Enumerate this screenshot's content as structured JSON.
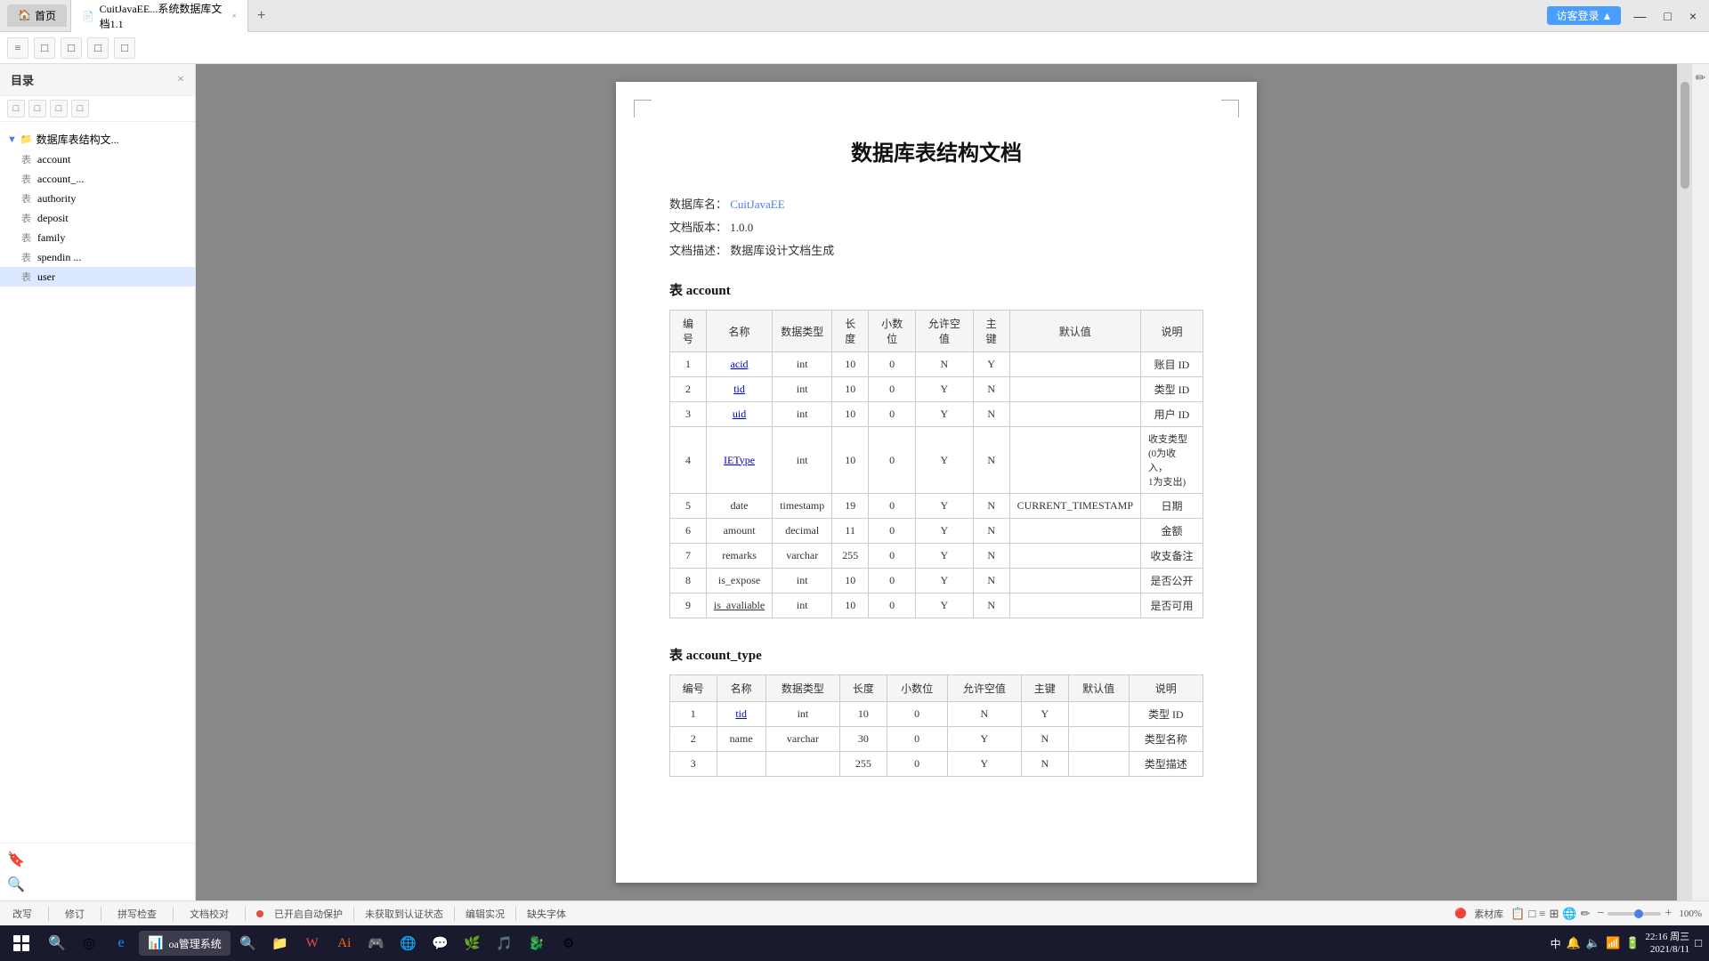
{
  "browser": {
    "tab_home": "首页",
    "tab_active_label": "CuitJavaEE...系统数据库文档1.1",
    "tab_close": "×",
    "tab_add": "+",
    "btn_minimize": "—",
    "btn_maximize": "□",
    "btn_close": "×",
    "user_badge": "访客登录 ▲"
  },
  "sidebar": {
    "title": "目录",
    "close": "×",
    "tree": [
      {
        "id": "root",
        "label": "数据库表结构文...",
        "type": "folder",
        "expanded": true
      },
      {
        "id": "account",
        "label": "表 account",
        "type": "table"
      },
      {
        "id": "account_type",
        "label": "表 account_...",
        "type": "table"
      },
      {
        "id": "authority",
        "label": "表 authority",
        "type": "table"
      },
      {
        "id": "deposit",
        "label": "表 deposit",
        "type": "table"
      },
      {
        "id": "family",
        "label": "表 family",
        "type": "table"
      },
      {
        "id": "spendin",
        "label": "表 spendin ...",
        "type": "table"
      },
      {
        "id": "user",
        "label": "表 user",
        "type": "table"
      }
    ]
  },
  "document": {
    "title": "数据库表结构文档",
    "meta": {
      "db_name_label": "数据库名：",
      "db_name_value": "CuitJavaEE",
      "doc_version_label": "文档版本：",
      "doc_version_value": "1.0.0",
      "doc_desc_label": "文档描述：",
      "doc_desc_value": "数据库设计文档生成"
    },
    "table_account": {
      "section_title": "表 account",
      "columns": [
        "编号",
        "名称",
        "数据类型",
        "长度",
        "小数位",
        "允许空值",
        "主键",
        "默认值",
        "说明"
      ],
      "rows": [
        [
          "1",
          "acid",
          "int",
          "10",
          "0",
          "N",
          "Y",
          "",
          "账目 ID"
        ],
        [
          "2",
          "tid",
          "int",
          "10",
          "0",
          "Y",
          "N",
          "",
          "类型 ID"
        ],
        [
          "3",
          "uid",
          "int",
          "10",
          "0",
          "Y",
          "N",
          "",
          "用户 ID"
        ],
        [
          "4",
          "IEType",
          "int",
          "10",
          "0",
          "Y",
          "N",
          "",
          "收支类型\n(0为收入，\n1为支出)"
        ],
        [
          "5",
          "date",
          "timestamp",
          "19",
          "0",
          "Y",
          "N",
          "CURRENT_TIMESTAMP",
          "日期"
        ],
        [
          "6",
          "amount",
          "decimal",
          "11",
          "0",
          "Y",
          "N",
          "",
          "金额"
        ],
        [
          "7",
          "remarks",
          "varchar",
          "255",
          "0",
          "Y",
          "N",
          "",
          "收支备注"
        ],
        [
          "8",
          "is_expose",
          "int",
          "10",
          "0",
          "Y",
          "N",
          "",
          "是否公开"
        ],
        [
          "9",
          "is_avaliable",
          "int",
          "10",
          "0",
          "Y",
          "N",
          "",
          "是否可用"
        ]
      ]
    },
    "table_account_type": {
      "section_title": "表 account_type",
      "columns": [
        "编号",
        "名称",
        "数据类型",
        "长度",
        "小数位",
        "允许空值",
        "主键",
        "默认值",
        "说明"
      ],
      "rows": [
        [
          "1",
          "tid",
          "int",
          "10",
          "0",
          "N",
          "Y",
          "",
          "类型 ID"
        ],
        [
          "2",
          "name",
          "varchar",
          "30",
          "0",
          "Y",
          "N",
          "",
          "类型名称"
        ],
        [
          "3",
          "...",
          "...",
          "255",
          "0",
          "Y",
          "N",
          "",
          "类型描述"
        ]
      ]
    }
  },
  "bottom_bar": {
    "buttons": [
      "改写",
      "修订",
      "拼写检查",
      "文档校对"
    ],
    "status_open": "已开启自动保护",
    "status_auth": "未获到认证状态",
    "status_edit": "编辑实况",
    "status_font": "缺失字体",
    "btn_materials": "素材库",
    "zoom_value": "100%"
  },
  "taskbar": {
    "apps": [
      "⊞",
      "🔍",
      "◎",
      "🌐",
      "📁",
      "🔍",
      "▶",
      "📄",
      "💬",
      "🌿",
      "📋",
      "🎮",
      "🌐",
      "🐉",
      "⚙"
    ],
    "active_app": "oa管理系统",
    "time": "22:16 周三",
    "date": "2021/8/11",
    "sys_tray": [
      "🔔",
      "🔈",
      "📶",
      "🔋"
    ]
  }
}
